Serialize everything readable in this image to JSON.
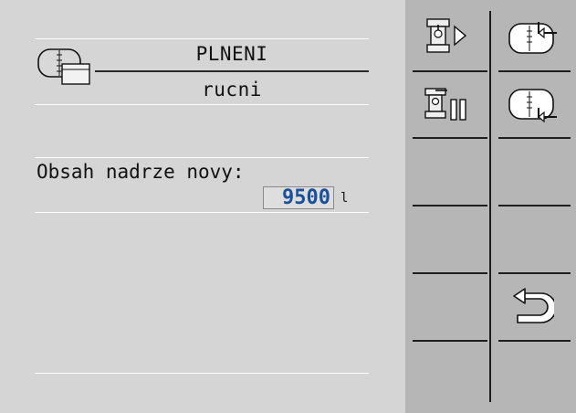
{
  "header": {
    "title": "PLNENI",
    "subtitle": "rucni",
    "icon": "tank-with-panel-icon"
  },
  "field": {
    "label": "Obsah nadrze novy:",
    "value": "9500",
    "unit": "l"
  },
  "colors": {
    "main_bg": "#d5d5d5",
    "softkey_bg": "#b6b6b6",
    "value_text": "#1a4f9a"
  },
  "softkeys": [
    {
      "id": "valve-play",
      "icon": "valve-play-icon"
    },
    {
      "id": "tank-fill",
      "icon": "tank-fill-arrow-icon"
    },
    {
      "id": "valve-pause",
      "icon": "valve-pause-icon"
    },
    {
      "id": "tank-empty",
      "icon": "tank-empty-arrow-icon"
    },
    {
      "id": "empty-1",
      "icon": ""
    },
    {
      "id": "empty-2",
      "icon": ""
    },
    {
      "id": "empty-3",
      "icon": ""
    },
    {
      "id": "empty-4",
      "icon": ""
    },
    {
      "id": "empty-5",
      "icon": ""
    },
    {
      "id": "back",
      "icon": "back-arrow-icon"
    }
  ]
}
